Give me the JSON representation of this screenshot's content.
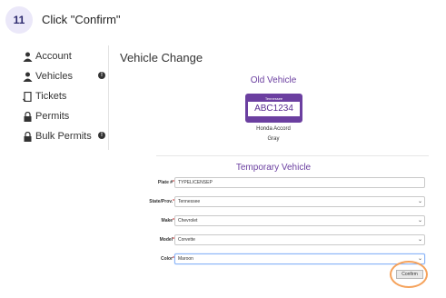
{
  "step": {
    "number": "11",
    "instruction": "Click \"Confirm\""
  },
  "sidebar": {
    "items": [
      {
        "label": "Account",
        "badge": ""
      },
      {
        "label": "Vehicles",
        "badge": "!"
      },
      {
        "label": "Tickets",
        "badge": ""
      },
      {
        "label": "Permits",
        "badge": ""
      },
      {
        "label": "Bulk Permits",
        "badge": "!"
      }
    ]
  },
  "main": {
    "title": "Vehicle Change",
    "old_vehicle": {
      "heading": "Old Vehicle",
      "plate_state": "Tennessee",
      "plate_number": "ABC1234",
      "make_model": "Honda Accord",
      "color": "Gray"
    },
    "temp_vehicle": {
      "heading": "Temporary Vehicle",
      "fields": [
        {
          "label": "Plate #",
          "value": "TYPELICENSEP",
          "type": "text"
        },
        {
          "label": "State/Prov.",
          "value": "Tennessee",
          "type": "select"
        },
        {
          "label": "Make",
          "value": "Chevrolet",
          "type": "select"
        },
        {
          "label": "Model",
          "value": "Corvette",
          "type": "select"
        },
        {
          "label": "Color",
          "value": "Maroon",
          "type": "select"
        }
      ],
      "confirm_label": "Confirm"
    }
  },
  "colors": {
    "accent": "#6b3fa0",
    "highlight_ring": "#f5a25b"
  }
}
